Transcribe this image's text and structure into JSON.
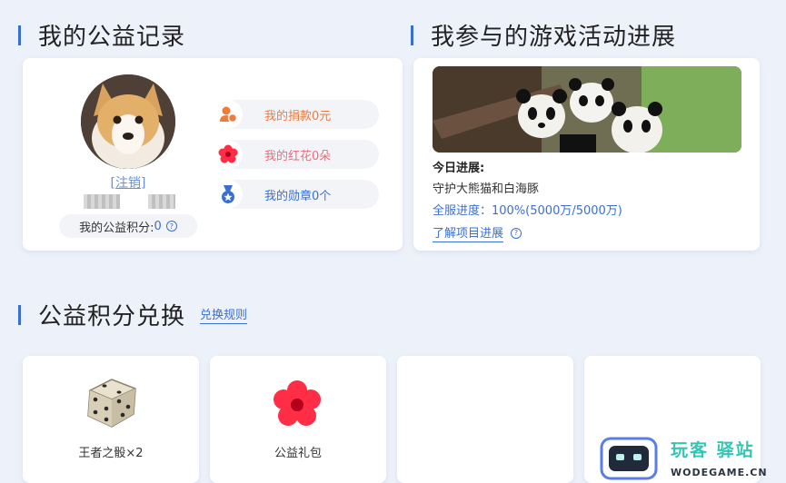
{
  "records": {
    "title": "我的公益记录",
    "logout": "[注销]",
    "points_label": "我的公益积分:",
    "points_value": "0",
    "help_glyph": "?",
    "stats": [
      {
        "label": "我的捐款0元",
        "color": "#f07a3a",
        "icon": "donate-icon"
      },
      {
        "label": "我的红花0朵",
        "color": "#ee6b7c",
        "icon": "red-flower-icon"
      },
      {
        "label": "我的勋章0个",
        "color": "#3a6fd2",
        "icon": "medal-icon"
      }
    ]
  },
  "activity": {
    "title": "我参与的游戏活动进展",
    "today_label": "今日进展:",
    "project": "守护大熊猫和白海豚",
    "progress_label": "全服进度：",
    "progress_value": "100%(5000万/5000万)",
    "progress_fraction": 1.0,
    "detail_link": "了解项目进展"
  },
  "exchange": {
    "title": "公益积分兑换",
    "rules_link": "兑换规则",
    "items": [
      {
        "label": "王者之骰×2",
        "icon": "dice-icon"
      },
      {
        "label": "公益礼包",
        "icon": "red-flower-icon"
      },
      {
        "label": ""
      },
      {
        "label": ""
      }
    ]
  },
  "watermark": {
    "brand": "玩客 驿站",
    "url": "WODEGAME.CN"
  },
  "colors": {
    "accent": "#3a6fd2",
    "orange": "#f07a3a",
    "pink": "#ee6b7c",
    "red": "#ff2d45"
  }
}
